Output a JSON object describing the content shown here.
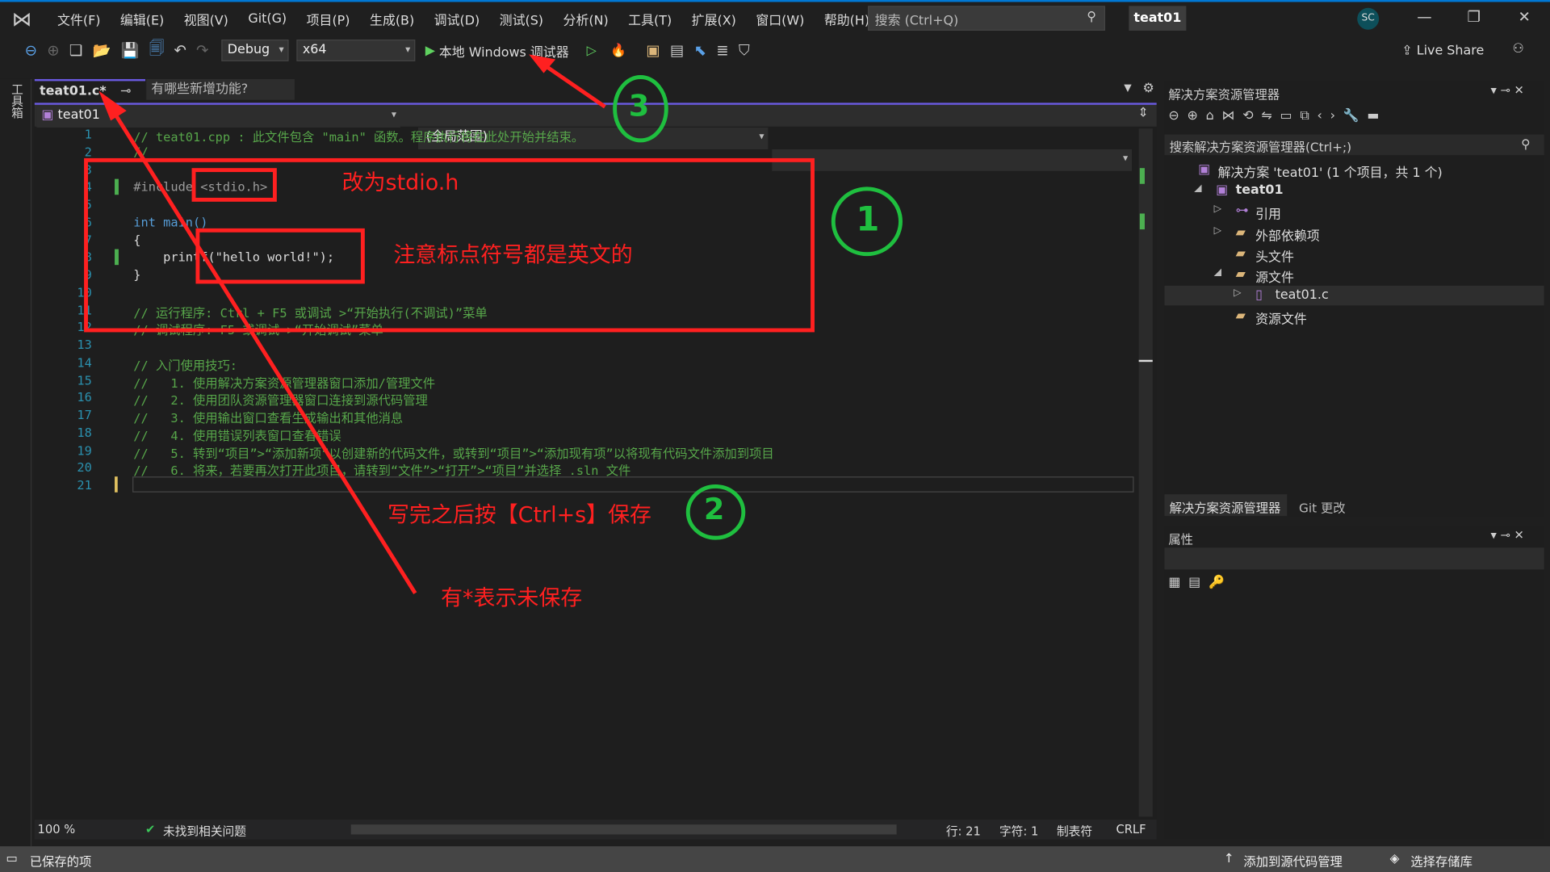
{
  "menu": [
    "文件(F)",
    "编辑(E)",
    "视图(V)",
    "Git(G)",
    "项目(P)",
    "生成(B)",
    "调试(D)",
    "测试(S)",
    "分析(N)",
    "工具(T)",
    "扩展(X)",
    "窗口(W)",
    "帮助(H)"
  ],
  "search": {
    "placeholder": "搜索 (Ctrl+Q)"
  },
  "project_name": "teat01",
  "user_initials": "SC",
  "toolbar": {
    "config": "Debug",
    "platform": "x64",
    "run_label": "本地 Windows 调试器",
    "live_share": "Live Share"
  },
  "left_tool_label": "工具箱",
  "tabs": [
    {
      "label": "teat01.c*",
      "active": true
    },
    {
      "label": "有哪些新增功能?",
      "active": false
    }
  ],
  "navbar": {
    "scope1": "teat01",
    "scope2": "(全局范围)"
  },
  "code_lines": [
    {
      "n": "1",
      "t": "// teat01.cpp : 此文件包含 \"main\" 函数。程序执行将在此处开始并结束。",
      "c": "cm"
    },
    {
      "n": "2",
      "t": "//",
      "c": "cm"
    },
    {
      "n": "3",
      "t": "",
      "c": "tx"
    },
    {
      "n": "4",
      "t": "#include <stdio.h>",
      "c": "pp"
    },
    {
      "n": "5",
      "t": "",
      "c": "tx"
    },
    {
      "n": "6",
      "t": "int main()",
      "c": "kw"
    },
    {
      "n": "7",
      "t": "{",
      "c": "tx"
    },
    {
      "n": "8",
      "t": "    printf(\"hello world!\");",
      "c": "tx"
    },
    {
      "n": "9",
      "t": "}",
      "c": "tx"
    },
    {
      "n": "10",
      "t": "",
      "c": "tx"
    },
    {
      "n": "11",
      "t": "// 运行程序: Ctrl + F5 或调试 >“开始执行(不调试)”菜单",
      "c": "cm"
    },
    {
      "n": "12",
      "t": "// 调试程序: F5 或调试 >“开始调试”菜单",
      "c": "cm"
    },
    {
      "n": "13",
      "t": "",
      "c": "tx"
    },
    {
      "n": "14",
      "t": "// 入门使用技巧:",
      "c": "cm"
    },
    {
      "n": "15",
      "t": "//   1. 使用解决方案资源管理器窗口添加/管理文件",
      "c": "cm"
    },
    {
      "n": "16",
      "t": "//   2. 使用团队资源管理器窗口连接到源代码管理",
      "c": "cm"
    },
    {
      "n": "17",
      "t": "//   3. 使用输出窗口查看生成输出和其他消息",
      "c": "cm"
    },
    {
      "n": "18",
      "t": "//   4. 使用错误列表窗口查看错误",
      "c": "cm"
    },
    {
      "n": "19",
      "t": "//   5. 转到“项目”>“添加新项”以创建新的代码文件，或转到“项目”>“添加现有项”以将现有代码文件添加到项目",
      "c": "cm"
    },
    {
      "n": "20",
      "t": "//   6. 将来，若要再次打开此项目，请转到“文件”>“打开”>“项目”并选择 .sln 文件",
      "c": "cm"
    },
    {
      "n": "21",
      "t": "",
      "c": "tx"
    }
  ],
  "editor_status": {
    "zoom": "100 %",
    "issues": "未找到相关问题",
    "line": "行: 21",
    "char": "字符: 1",
    "tabs": "制表符",
    "eol": "CRLF"
  },
  "solution_explorer": {
    "title": "解决方案资源管理器",
    "search_placeholder": "搜索解决方案资源管理器(Ctrl+;)",
    "items": [
      {
        "label": "解决方案 'teat01' (1 个项目，共 1 个)",
        "icon": "solution-icon"
      },
      {
        "label": "teat01",
        "icon": "project-icon"
      },
      {
        "label": "引用",
        "icon": "references-icon"
      },
      {
        "label": "外部依赖项",
        "icon": "folder-icon"
      },
      {
        "label": "头文件",
        "icon": "filter-folder-icon"
      },
      {
        "label": "源文件",
        "icon": "filter-folder-icon"
      },
      {
        "label": "teat01.c",
        "icon": "c-file-icon",
        "selected": true
      },
      {
        "label": "资源文件",
        "icon": "filter-folder-icon"
      }
    ],
    "bottom_tabs": [
      "解决方案资源管理器",
      "Git 更改"
    ]
  },
  "properties": {
    "title": "属性"
  },
  "statusbar": {
    "left": "已保存的项",
    "source_control": "添加到源代码管理",
    "repo": "选择存储库"
  },
  "annotations": {
    "stdio": "改为stdio.h",
    "punct": "注意标点符号都是英文的",
    "save": "写完之后按【Ctrl+s】保存",
    "unsaved": "有*表示未保存",
    "num1": "1",
    "num2": "2",
    "num3": "3"
  },
  "colors": {
    "accent": "#0078d4",
    "tab_active": "#6a5ae0",
    "annotation_red": "#ff2020",
    "annotation_green": "#1fbf3f",
    "comment": "#57a64a"
  }
}
